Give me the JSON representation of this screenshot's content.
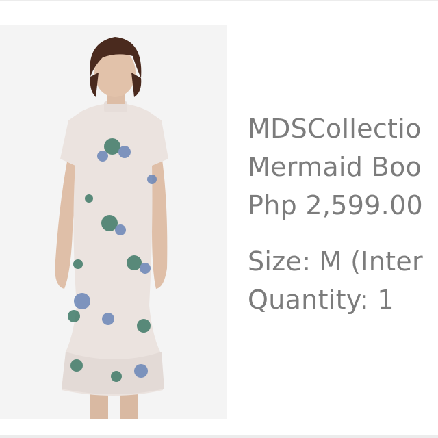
{
  "product": {
    "brand_line": "MDSCollectio",
    "name_line": "Mermaid Boo",
    "price": "Php 2,599.00",
    "image_icon": "dress-photo"
  },
  "order": {
    "size": "Size: M (Inter",
    "quantity": "Quantity: 1"
  },
  "colors": {
    "text": "#7c7c7c",
    "image_bg": "#f4f4f4",
    "dress": "#ebe3df",
    "floral_blue": "#6a86b8",
    "floral_green": "#3f7a68"
  }
}
